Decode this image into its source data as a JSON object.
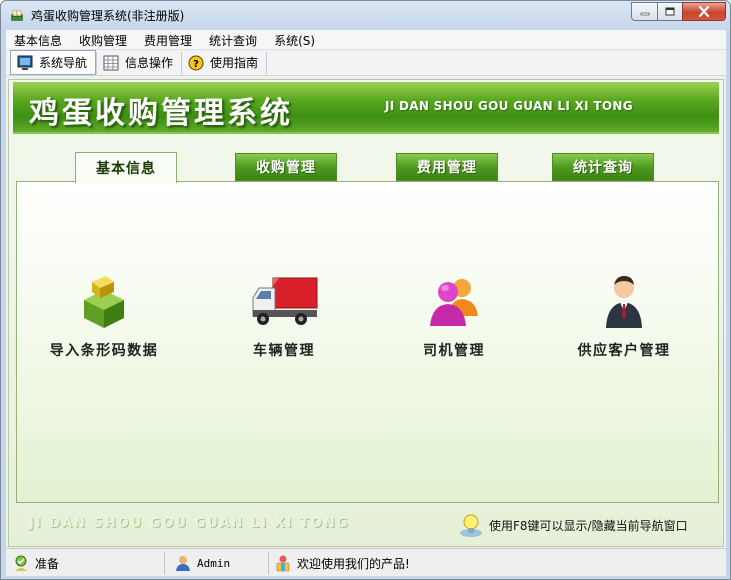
{
  "window": {
    "title": "鸡蛋收购管理系统(非注册版)"
  },
  "menubar": {
    "items": [
      "基本信息",
      "收购管理",
      "费用管理",
      "统计查询",
      "系统(S)"
    ]
  },
  "toolbar": {
    "nav": "系统导航",
    "info": "信息操作",
    "guide": "使用指南"
  },
  "banner": {
    "title": "鸡蛋收购管理系统",
    "subtitle": "JI DAN SHOU GOU GUAN LI XI TONG"
  },
  "tabs": [
    {
      "label": "基本信息",
      "active": true
    },
    {
      "label": "收购管理",
      "active": false
    },
    {
      "label": "费用管理",
      "active": false
    },
    {
      "label": "统计查询",
      "active": false
    }
  ],
  "functions": [
    {
      "label": "导入条形码数据",
      "icon": "box-import-icon"
    },
    {
      "label": "车辆管理",
      "icon": "truck-icon"
    },
    {
      "label": "司机管理",
      "icon": "users-icon"
    },
    {
      "label": "供应客户管理",
      "icon": "customer-icon"
    }
  ],
  "footer": {
    "text": "JI DAN SHOU GOU GUAN LI XI TONG",
    "hint": "使用F8键可以显示/隐藏当前导航窗口"
  },
  "statusbar": {
    "state": "准备",
    "user": "Admin",
    "message": "欢迎使用我们的产品!"
  },
  "colors": {
    "banner_green": "#3d8f13",
    "tab_green": "#4e9a20",
    "panel_bg": "#e5f1d7"
  }
}
